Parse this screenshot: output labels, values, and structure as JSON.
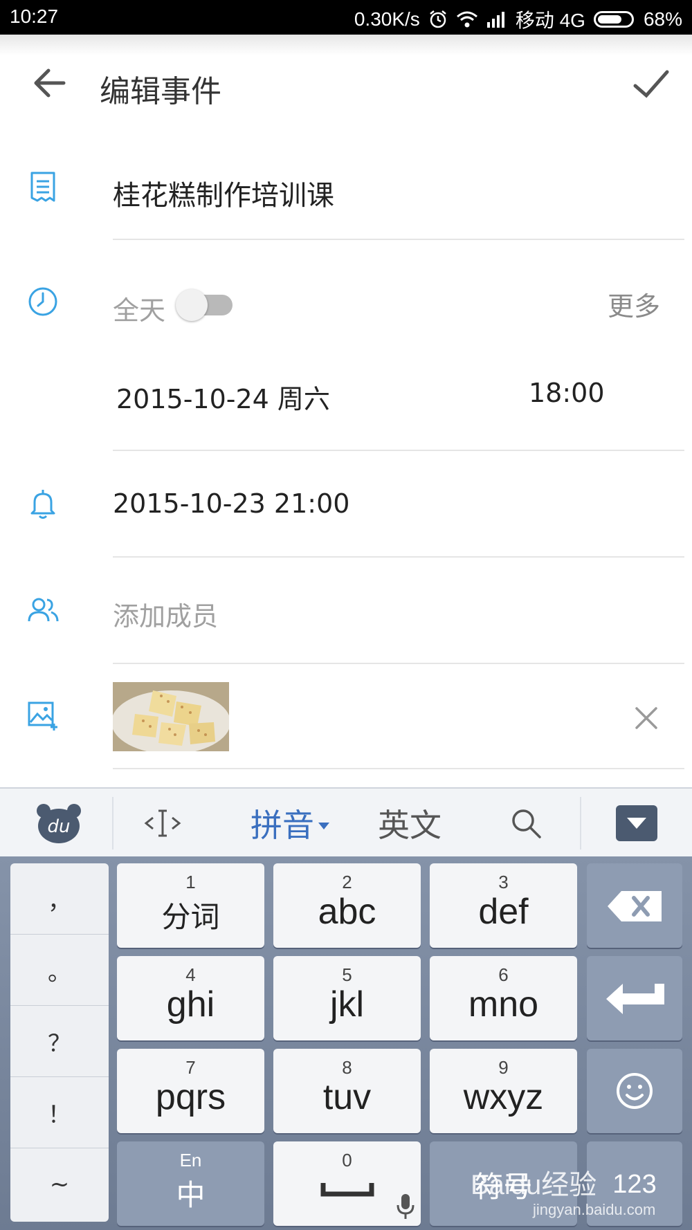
{
  "status_bar": {
    "time": "10:27",
    "net_speed": "0.30K/s",
    "carrier": "移动 4G",
    "battery": "68%"
  },
  "header": {
    "title": "编辑事件",
    "back_icon": "arrow-left-icon",
    "confirm_icon": "check-icon"
  },
  "event": {
    "title": "桂花糕制作培训课",
    "all_day_label": "全天",
    "all_day_on": false,
    "more_label": "更多",
    "date": "2015-10-24 周六",
    "time": "18:00",
    "reminder": "2015-10-23 21:00",
    "members_placeholder": "添加成员"
  },
  "icons": {
    "title": "note-icon",
    "time": "clock-icon",
    "reminder": "bell-icon",
    "members": "people-icon",
    "image": "image-add-icon",
    "remove": "close-icon"
  },
  "keyboard": {
    "toolbar": {
      "logo": "du",
      "cursor_icon": "cursor-move-icon",
      "pinyin": "拼音",
      "english": "英文",
      "search_icon": "search-icon",
      "hide_icon": "keyboard-hide-icon"
    },
    "punctuation": [
      "，",
      "。",
      "？",
      "！",
      "~"
    ],
    "keys": [
      {
        "num": "1",
        "label": "分词"
      },
      {
        "num": "2",
        "label": "abc"
      },
      {
        "num": "3",
        "label": "def"
      },
      {
        "num": "4",
        "label": "ghi"
      },
      {
        "num": "5",
        "label": "jkl"
      },
      {
        "num": "6",
        "label": "mno"
      },
      {
        "num": "7",
        "label": "pqrs"
      },
      {
        "num": "8",
        "label": "tuv"
      },
      {
        "num": "9",
        "label": "wxyz"
      }
    ],
    "lang_key": {
      "top": "En",
      "label": "中"
    },
    "space_key": {
      "num": "0"
    },
    "symbol_key": "符号",
    "num_key": "123",
    "backspace_icon": "backspace-icon",
    "enter_icon": "enter-icon",
    "emoji_icon": "emoji-icon",
    "mic_icon": "mic-icon"
  },
  "watermark": {
    "brand": "Baidu经验",
    "url": "jingyan.baidu.com"
  },
  "colors": {
    "accent_blue": "#3aa3e3",
    "keyboard_bg": "#7a879c",
    "pinyin_blue": "#3a6fbf"
  }
}
